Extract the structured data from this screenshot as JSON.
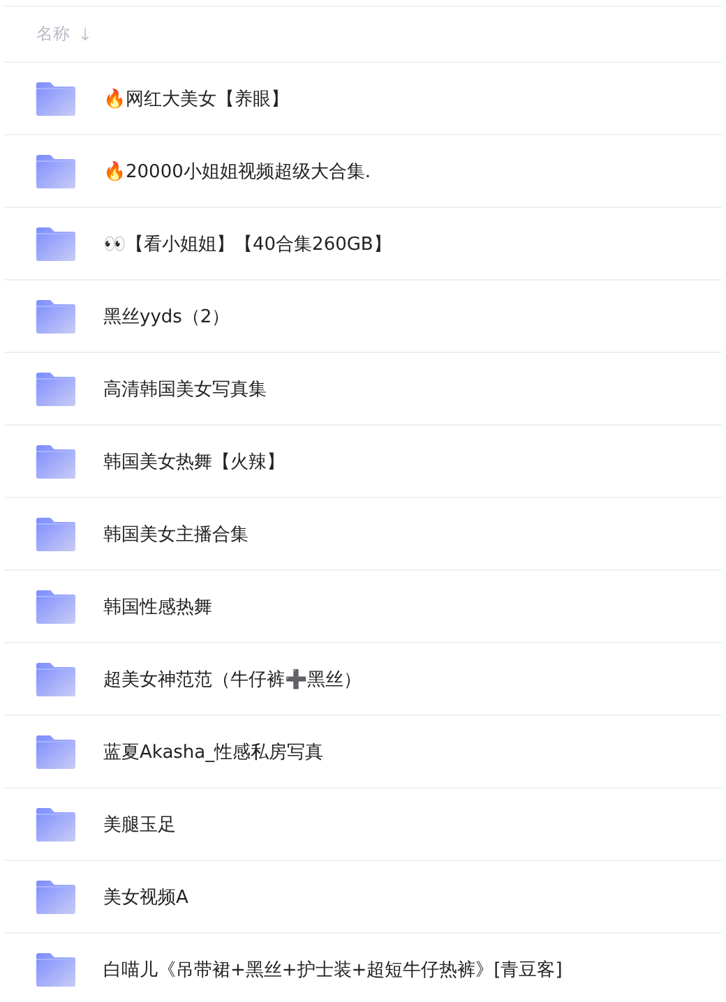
{
  "header": {
    "label": "名称",
    "sort_icon": "↓"
  },
  "folders": [
    {
      "name": "🔥网红大美女【养眼】"
    },
    {
      "name": "🔥20000小姐姐视频超级大合集."
    },
    {
      "name": "👀【看小姐姐】【40合集260GB】"
    },
    {
      "name": "黑丝yyds（2）"
    },
    {
      "name": "高清韩国美女写真集"
    },
    {
      "name": "韩国美女热舞【火辣】"
    },
    {
      "name": "韩国美女主播合集"
    },
    {
      "name": "韩国性感热舞"
    },
    {
      "name": "超美女神范范（牛仔裤➕黑丝）"
    },
    {
      "name": "蓝夏Akasha_性感私房写真"
    },
    {
      "name": "美腿玉足"
    },
    {
      "name": "美女视频A"
    },
    {
      "name": "白喵儿《吊带裙+黑丝+护士装+超短牛仔热裤》[青豆客]"
    }
  ]
}
